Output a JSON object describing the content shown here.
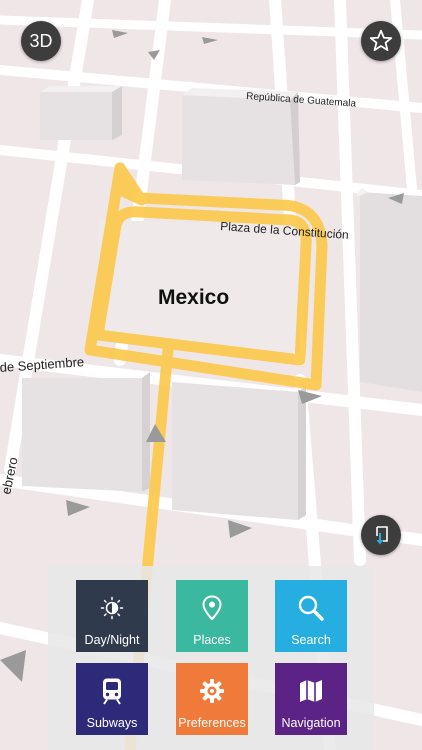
{
  "map": {
    "city_label": "Mexico",
    "streets": {
      "republica": "República de Guatemala",
      "plaza": "Plaza de la Constitución",
      "septiembre": "de Septiembre",
      "febrero": "ebrero"
    }
  },
  "controls": {
    "view_mode_label": "3D",
    "favorites_icon": "star-icon",
    "export_icon": "download-icon"
  },
  "menu": {
    "tiles": [
      {
        "label": "Day/Night",
        "icon": "day-night-icon",
        "color": "#2f3b4c"
      },
      {
        "label": "Places",
        "icon": "map-pin-icon",
        "color": "#3bb9a0"
      },
      {
        "label": "Search",
        "icon": "search-icon",
        "color": "#27aee0"
      },
      {
        "label": "Subways",
        "icon": "subway-icon",
        "color": "#2e2a7a"
      },
      {
        "label": "Preferences",
        "icon": "gear-icon",
        "color": "#f07a3a"
      },
      {
        "label": "Navigation",
        "icon": "map-icon",
        "color": "#5b2385"
      }
    ]
  },
  "colors": {
    "route": "#fdc94d",
    "map_bg": "#efe6e8",
    "road": "#ffffff",
    "building": "#e4e0e1"
  }
}
